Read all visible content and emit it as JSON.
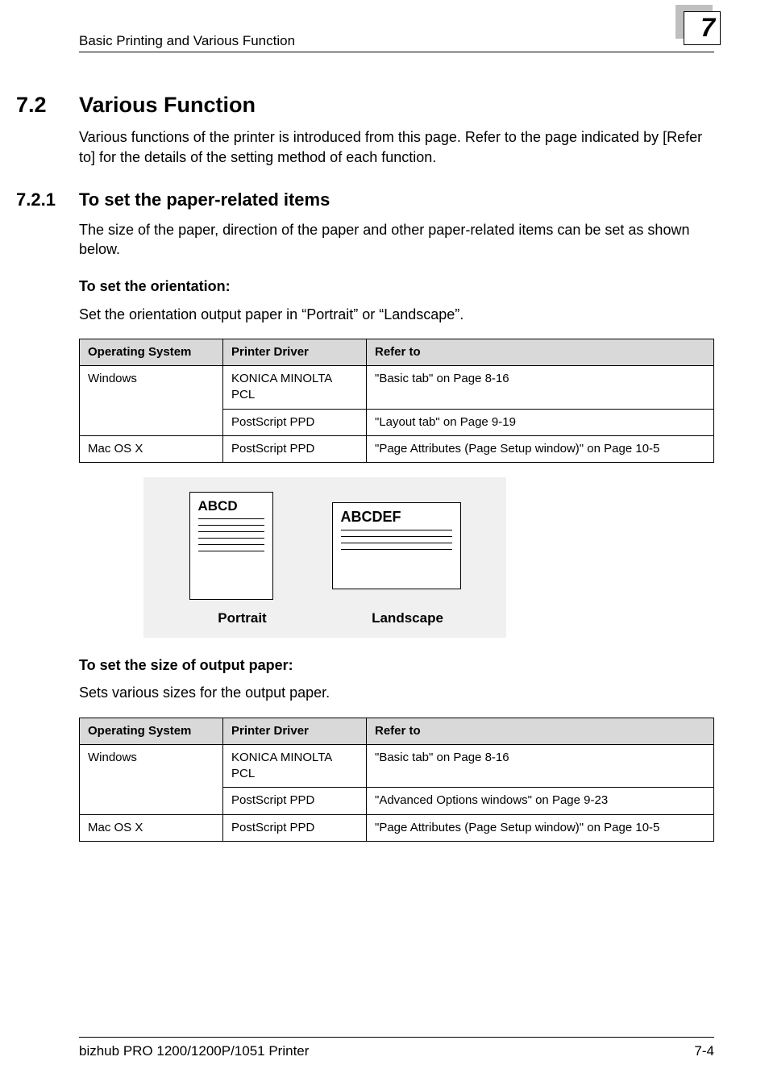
{
  "header": {
    "running_title": "Basic Printing and Various Function",
    "chapter_number": "7"
  },
  "section": {
    "number": "7.2",
    "title": "Various Function",
    "intro": "Various functions of the printer is introduced from this page. Refer to the page indicated by [Refer to] for the details of the setting method of each function."
  },
  "subsection": {
    "number": "7.2.1",
    "title": "To set the paper-related items",
    "intro": "The size of the paper, direction of the paper and other paper-related items can be set as shown below."
  },
  "table_headers": {
    "os": "Operating System",
    "driver": "Printer Driver",
    "refer": "Refer to"
  },
  "orientation": {
    "heading": "To set the orientation:",
    "body": "Set the orientation output paper in “Portrait” or “Landscape”.",
    "rows": [
      {
        "os": "Windows",
        "driver": "KONICA MINOLTA PCL",
        "refer": "\"Basic tab\" on Page 8-16"
      },
      {
        "os": "",
        "driver": "PostScript PPD",
        "refer": "\"Layout tab\" on Page 9-19"
      },
      {
        "os": "Mac OS X",
        "driver": "PostScript PPD",
        "refer": "\"Page Attributes (Page Setup window)\" on Page 10-5"
      }
    ]
  },
  "figure": {
    "portrait_text": "ABCD",
    "landscape_text": "ABCDEF",
    "label_portrait": "Portrait",
    "label_landscape": "Landscape"
  },
  "size": {
    "heading": "To set the size of output paper:",
    "body": "Sets various sizes for the output paper.",
    "rows": [
      {
        "os": "Windows",
        "driver": "KONICA MINOLTA PCL",
        "refer": "\"Basic tab\" on Page 8-16"
      },
      {
        "os": "",
        "driver": "PostScript PPD",
        "refer": "\"Advanced Options windows\" on Page 9-23"
      },
      {
        "os": "Mac OS X",
        "driver": "PostScript PPD",
        "refer": "\"Page Attributes (Page Setup window)\" on Page 10-5"
      }
    ]
  },
  "footer": {
    "left": "bizhub PRO 1200/1200P/1051 Printer",
    "right": "7-4"
  }
}
